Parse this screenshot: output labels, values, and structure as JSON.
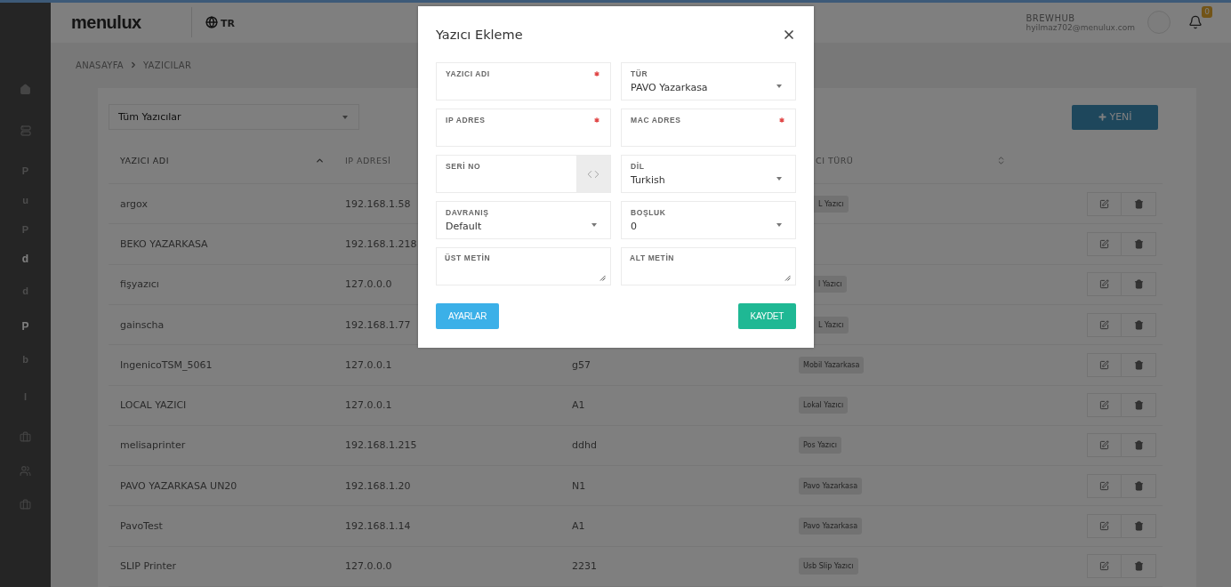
{
  "sidebar": {
    "items": [
      {
        "kind": "home"
      },
      {
        "kind": "server"
      },
      {
        "kind": "letter",
        "label": "P"
      },
      {
        "kind": "letter",
        "label": "u"
      },
      {
        "kind": "letter",
        "label": "P"
      },
      {
        "kind": "letter",
        "label": "d",
        "bright": true
      },
      {
        "kind": "letter",
        "label": "d",
        "bright": false
      },
      {
        "kind": "letter",
        "label": "P",
        "bright": true
      },
      {
        "kind": "letter",
        "label": "b"
      },
      {
        "kind": "letter",
        "label": "l"
      },
      {
        "kind": "briefcase"
      },
      {
        "kind": "users"
      },
      {
        "kind": "briefcase"
      }
    ]
  },
  "header": {
    "logo": "menulux",
    "language": "TR",
    "user_name": "BREWHUB",
    "user_email": "hyilmaz702@menulux.com",
    "notification_count": "0"
  },
  "breadcrumb": [
    "ANASAYFA",
    "YAZICILAR"
  ],
  "filter": {
    "value": "Tüm Yazıcılar"
  },
  "new_button": "YENİ",
  "table": {
    "columns": [
      {
        "label": "YAZICI ADI",
        "sorted": true
      },
      {
        "label": "IP ADRESİ"
      },
      {
        "label": "CI TÜRÜ",
        "sorted": false
      }
    ],
    "rows": [
      {
        "name": "argox",
        "ip": "192.168.1.58",
        "type": "L Yazıcı"
      },
      {
        "name": "BEKO YAZARKASA",
        "ip": "192.168.1.218"
      },
      {
        "name": "fişyazıcı",
        "ip": "127.0.0.0",
        "type": "l Yazıcı"
      },
      {
        "name": "gainscha",
        "ip": "192.168.1.77",
        "type": "L Yazıcı"
      },
      {
        "name": "IngenicoTSM_5061",
        "ip": "127.0.0.1",
        "column_3": "g57",
        "type": "Mobil Yazarkasa"
      },
      {
        "name": "LOCAL YAZICI",
        "ip": "127.0.0.1",
        "column_3": "A1",
        "type": "Lokal Yazıcı"
      },
      {
        "name": "melisaprinter",
        "ip": "192.168.1.215",
        "column_3": "ddhd",
        "type": "Pos Yazıcı"
      },
      {
        "name": "PAVO YAZARKASA UN20",
        "ip": "192.168.1.20",
        "column_3": "N1",
        "type": "Pavo Yazarkasa"
      },
      {
        "name": "PavoTest",
        "ip": "192.168.1.14",
        "column_3": "A1",
        "type": "Pavo Yazarkasa"
      },
      {
        "name": "SLIP Printer",
        "ip": "127.0.0.0",
        "column_3": "2231",
        "type": "Usb Slip Yazıcı"
      }
    ]
  },
  "dialog": {
    "title": "Yazıcı Ekleme",
    "fields": [
      {
        "label": "YAZICI ADI",
        "kind": "text",
        "required": true
      },
      {
        "label": "TÜR",
        "kind": "select",
        "value": "PAVO Yazarkasa"
      },
      {
        "label": "IP ADRES",
        "kind": "text",
        "required": true
      },
      {
        "label": "MAC ADRES",
        "kind": "text",
        "required": true
      },
      {
        "label": "SERİ NO",
        "kind": "code"
      },
      {
        "label": "DİL",
        "kind": "select",
        "value": "Turkish"
      },
      {
        "label": "DAVRANIŞ",
        "kind": "select",
        "value": "Default"
      },
      {
        "label": "BOŞLUK",
        "kind": "select",
        "value": "0"
      },
      {
        "label": "ÜST METİN",
        "kind": "textarea"
      },
      {
        "label": "ALT METİN",
        "kind": "textarea"
      }
    ],
    "buttons": [
      {
        "label": "AYARLAR",
        "kind": "secondary"
      },
      {
        "label": "KAYDET",
        "kind": "primary"
      }
    ]
  }
}
